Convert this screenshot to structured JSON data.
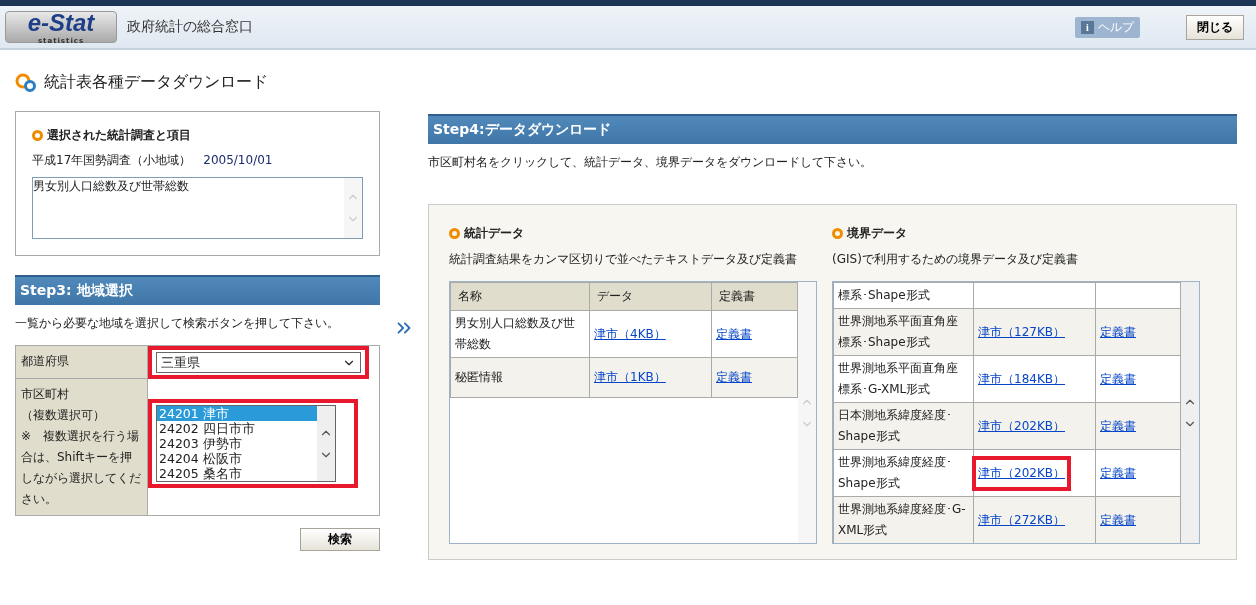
{
  "header": {
    "logo_text": "e-Stat",
    "logo_subtext": "statistics",
    "portal_title": "政府統計の総合窓口",
    "help_icon": "i",
    "help": "ヘルプ",
    "close": "閉じる"
  },
  "page_title": "統計表各種データダウンロード",
  "selected_survey": {
    "heading": "選択された統計調査と項目",
    "survey": "平成17年国勢調査（小地域）",
    "date": "2005/10/01",
    "items": [
      "男女別人口総数及び世帯総数"
    ]
  },
  "step3": {
    "title": "Step3: 地域選択",
    "instruction": "一覧から必要な地域を選択して検索ボタンを押して下さい。",
    "prefecture_label": "都道府県",
    "prefecture": {
      "value": "三重県",
      "highlighted": true
    },
    "municipality_label": "市区町村",
    "municipality_note": "（複数選択可）",
    "municipality_help": "※　複数選択を行う場合は、Shiftキーを押しながら選択してください。",
    "municipalities": {
      "highlighted": true,
      "options": [
        {
          "label": "24201 津市",
          "selected": true
        },
        {
          "label": "24202 四日市市",
          "selected": false
        },
        {
          "label": "24203 伊勢市",
          "selected": false
        },
        {
          "label": "24204 松阪市",
          "selected": false
        },
        {
          "label": "24205 桑名市",
          "selected": false
        }
      ]
    },
    "search_button": "検索"
  },
  "step4": {
    "title": "Step4:データダウンロード",
    "instruction": "市区町村名をクリックして、統計データ、境界データをダウンロードして下さい。",
    "statistics": {
      "heading": "統計データ",
      "description": "統計調査結果をカンマ区切りで並べたテキストデータ及び定義書",
      "columns": [
        "名称",
        "データ",
        "定義書"
      ],
      "rows": [
        {
          "name": "男女別人口総数及び世帯総数",
          "data": "津市（4KB）",
          "definition": "定義書",
          "highlighted": false
        },
        {
          "name": "秘匿情報",
          "data": "津市（1KB）",
          "definition": "定義書",
          "highlighted": false
        }
      ]
    },
    "boundary": {
      "heading": "境界データ",
      "description": "(GIS)で利用するための境界データ及び定義書",
      "rows": [
        {
          "name": "標系･Shape形式"
        },
        {
          "name": "世界測地系平面直角座標系･Shape形式",
          "data": "津市（127KB）",
          "definition": "定義書",
          "highlighted": false
        },
        {
          "name": "世界測地系平面直角座標系･G-XML形式",
          "data": "津市（184KB）",
          "definition": "定義書",
          "highlighted": false
        },
        {
          "name": "日本測地系緯度経度･Shape形式",
          "data": "津市（202KB）",
          "definition": "定義書",
          "highlighted": false
        },
        {
          "name": "世界測地系緯度経度･Shape形式",
          "data": "津市（202KB）",
          "definition": "定義書",
          "highlighted": true
        },
        {
          "name": "世界測地系緯度経度･G-XML形式",
          "data": "津市（272KB）",
          "definition": "定義書",
          "highlighted": false
        }
      ]
    }
  }
}
